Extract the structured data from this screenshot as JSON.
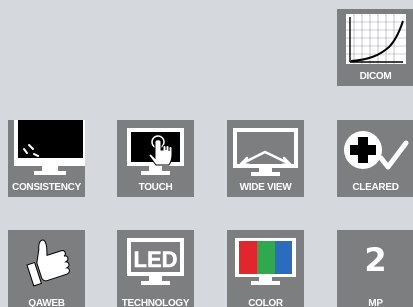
{
  "tiles": [
    {
      "id": "dicom",
      "label": "DICOM",
      "icon": "dicom-curve-chart-icon"
    },
    {
      "id": "consistency",
      "label": "CONSISTENCY",
      "icon": "monitor-consistency-icon"
    },
    {
      "id": "touch",
      "label": "TOUCH",
      "icon": "touch-monitor-icon"
    },
    {
      "id": "wide-view",
      "label": "WIDE VIEW",
      "icon": "wide-view-monitor-icon"
    },
    {
      "id": "cleared",
      "label": "CLEARED",
      "icon": "medical-cross-check-icon"
    },
    {
      "id": "qaweb",
      "label": "QAWEB",
      "icon": "thumbs-up-icon"
    },
    {
      "id": "led-technology",
      "label": "TECHNOLOGY",
      "icon": "led-monitor-icon",
      "icon_text": "LED"
    },
    {
      "id": "color",
      "label": "COLOR",
      "icon": "rgb-color-monitor-icon"
    },
    {
      "id": "megapixel",
      "label": "MP",
      "value": "2"
    }
  ],
  "colors": {
    "background": "#d5d8dc",
    "tile": "#7d7e80",
    "icon": "#ffffff",
    "screen": "#000000",
    "red": "#e3262e",
    "green": "#2fa84f",
    "blue": "#2c6cc0"
  }
}
